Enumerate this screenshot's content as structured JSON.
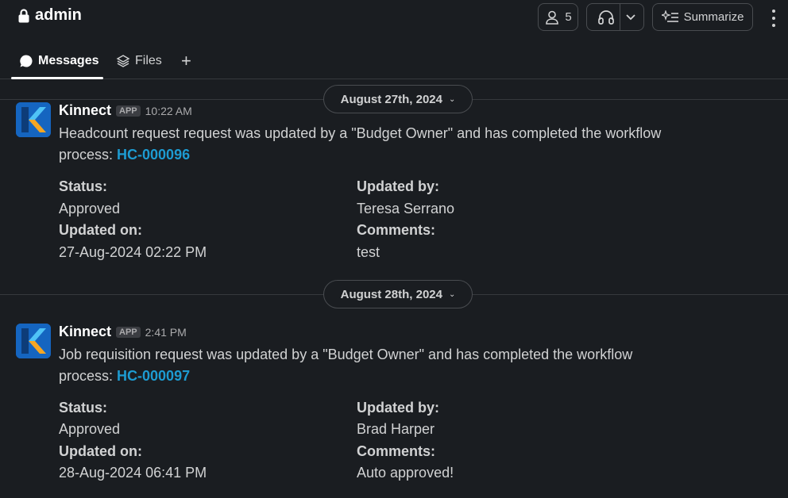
{
  "header": {
    "channel": "admin",
    "member_count": "5",
    "summarize_label": "Summarize"
  },
  "tabs": [
    {
      "label": "Messages"
    },
    {
      "label": "Files"
    },
    {
      "label": "+"
    }
  ],
  "dates": [
    {
      "label": "August 27th, 2024"
    },
    {
      "label": "August 28th, 2024"
    }
  ],
  "messages": [
    {
      "sender": "Kinnect",
      "badge": "APP",
      "time": "10:22 AM",
      "text": "Headcount request request was updated by a \"Budget Owner\" and has completed the workflow process: ",
      "link": "HC-000096",
      "fields": {
        "status_label": "Status:",
        "status_value": "Approved",
        "updated_by_label": "Updated by:",
        "updated_by_value": "Teresa Serrano",
        "updated_on_label": "Updated on:",
        "updated_on_value": "27-Aug-2024 02:22 PM",
        "comments_label": "Comments:",
        "comments_value": "test"
      }
    },
    {
      "sender": "Kinnect",
      "badge": "APP",
      "time": "2:41 PM",
      "text": "Job requisition request was updated by a \"Budget Owner\" and has completed the workflow process: ",
      "link": "HC-000097",
      "fields": {
        "status_label": "Status:",
        "status_value": "Approved",
        "updated_by_label": "Updated by:",
        "updated_by_value": "Brad Harper",
        "updated_on_label": "Updated on:",
        "updated_on_value": "28-Aug-2024 06:41 PM",
        "comments_label": "Comments:",
        "comments_value": "Auto approved!"
      }
    }
  ],
  "colors": {
    "background": "#1a1d21",
    "link": "#1d9bd1",
    "avatar_blue": "#1565c0",
    "avatar_orange": "#f5a623"
  },
  "icons": [
    "lock-icon",
    "person-icon",
    "headphones-icon",
    "chevron-down-icon",
    "sparkle-list-icon",
    "kebab-icon",
    "chat-bubble-icon",
    "layers-icon",
    "plus-icon"
  ]
}
